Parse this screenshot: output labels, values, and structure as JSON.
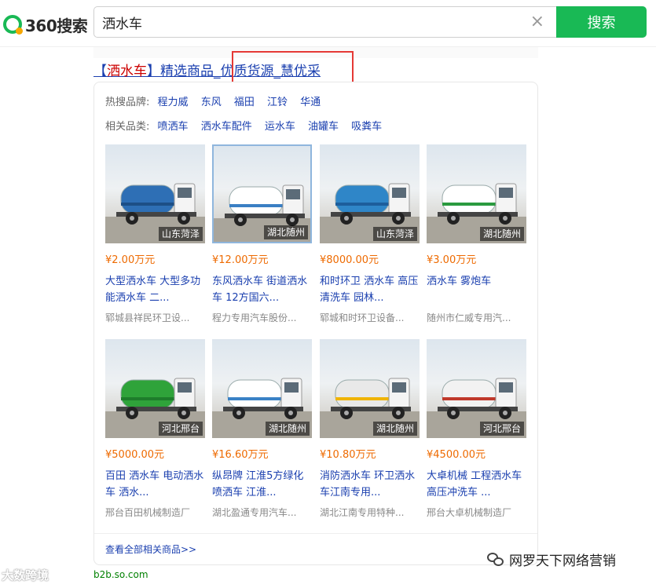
{
  "header": {
    "logo_text": "360搜索",
    "search_value": "洒水车",
    "clear_glyph": "×",
    "search_button": "搜索"
  },
  "result": {
    "title_bracket_open": "【",
    "title_keyword": "洒水车",
    "title_rest": "】精选商品_优质货源_慧优采",
    "url": "b2b.so.com"
  },
  "card": {
    "hot_brands_label": "热搜品牌:",
    "hot_brands": [
      "程力威",
      "东风",
      "福田",
      "江铃",
      "华通"
    ],
    "related_label": "相关品类:",
    "related": [
      "喷洒车",
      "洒水车配件",
      "运水车",
      "油罐车",
      "吸粪车"
    ],
    "view_all": "查看全部相关商品>>",
    "products": [
      {
        "location": "山东菏泽",
        "price": "¥2.00万元",
        "name": "大型洒水车 大型多功能洒水车 二...",
        "seller": "郓城县祥民环卫设..."
      },
      {
        "location": "湖北随州",
        "price": "¥12.00万元",
        "name": "东风洒水车 街道洒水车 12方国六...",
        "seller": "程力专用汽车股份..."
      },
      {
        "location": "山东菏泽",
        "price": "¥8000.00元",
        "name": "和时环卫 洒水车 高压清洗车 园林...",
        "seller": "郓城和时环卫设备..."
      },
      {
        "location": "湖北随州",
        "price": "¥3.00万元",
        "name": "洒水车 雾炮车",
        "seller": "随州市仁威专用汽..."
      },
      {
        "location": "河北邢台",
        "price": "¥5000.00元",
        "name": "百田 洒水车 电动洒水车 洒水...",
        "seller": "邢台百田机械制造厂"
      },
      {
        "location": "湖北随州",
        "price": "¥16.60万元",
        "name": "纵昂牌 江淮5方绿化喷洒车 江淮...",
        "seller": "湖北盈通专用汽车..."
      },
      {
        "location": "湖北随州",
        "price": "¥10.80万元",
        "name": "消防洒水车 环卫洒水车江南专用...",
        "seller": "湖北江南专用特种..."
      },
      {
        "location": "河北邢台",
        "price": "¥4500.00元",
        "name": "大卓机械 工程洒水车 高压冲洗车 ...",
        "seller": "邢台大卓机械制造厂"
      }
    ]
  },
  "watermarks": {
    "left": "大数跨境",
    "right": "网罗天下网络营销"
  },
  "colors": {
    "brand_green": "#19b955",
    "link_blue": "#1a3faf",
    "price_orange": "#ee6a00",
    "highlight_red": "#e53935",
    "url_green": "#008000"
  }
}
